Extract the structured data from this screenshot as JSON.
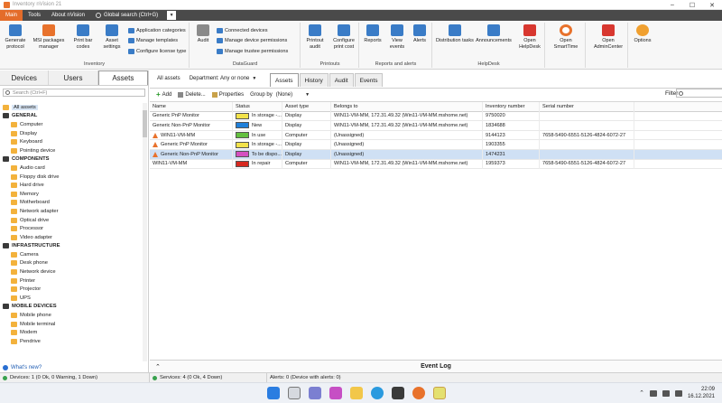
{
  "window": {
    "title": "Inventory nVision 21"
  },
  "menu_tabs": [
    {
      "label": "Main",
      "active": true
    },
    {
      "label": "Tools",
      "active": false
    },
    {
      "label": "About nVision",
      "active": false
    },
    {
      "label": "Global search (Ctrl+G)",
      "active": false
    }
  ],
  "ribbon": {
    "groups": {
      "inventory": "Inventory",
      "dataguard": "DataGuard",
      "printouts": "Printouts",
      "reports_alerts": "Reports and alerts",
      "helpdesk": "HelpDesk"
    },
    "buttons": {
      "generate_protocol": "Generate protocol",
      "msi_packages": "MSI packages manager",
      "print_bar_codes": "Print bar codes",
      "asset_settings": "Asset settings",
      "application_categories": "Application categories",
      "manage_templates": "Manage templates",
      "configure_license_type": "Configure license type",
      "audit": "Audit",
      "connected_devices": "Connected devices",
      "manage_device_permissions": "Manage device permissions",
      "manage_trustee_permissions": "Manage trustee permissions",
      "printout_audit": "Printout audit",
      "configure_print_cost": "Configure print cost",
      "reports": "Reports",
      "view_events": "View events",
      "alerts": "Alerts",
      "distribution_tasks": "Distribution tasks",
      "announcements": "Announcements",
      "open_helpdesk": "Open HelpDesk",
      "open_smarttime": "Open SmartTime",
      "open_admincenter": "Open AdminCenter",
      "options": "Options"
    }
  },
  "left_panel": {
    "tabs": [
      {
        "label": "Devices",
        "active": false
      },
      {
        "label": "Users",
        "active": false
      },
      {
        "label": "Assets",
        "active": true
      }
    ],
    "search_placeholder": "Search (Ctrl+F)",
    "tree": [
      {
        "kind": "root",
        "label": "All assets"
      },
      {
        "kind": "cat",
        "label": "GENERAL"
      },
      {
        "kind": "item",
        "label": "Computer"
      },
      {
        "kind": "item",
        "label": "Display"
      },
      {
        "kind": "item",
        "label": "Keyboard"
      },
      {
        "kind": "item",
        "label": "Pointing device"
      },
      {
        "kind": "cat",
        "label": "COMPONENTS"
      },
      {
        "kind": "item",
        "label": "Audio card"
      },
      {
        "kind": "item",
        "label": "Floppy disk drive"
      },
      {
        "kind": "item",
        "label": "Hard drive"
      },
      {
        "kind": "item",
        "label": "Memory"
      },
      {
        "kind": "item",
        "label": "Motherboard"
      },
      {
        "kind": "item",
        "label": "Network adapter"
      },
      {
        "kind": "item",
        "label": "Optical drive"
      },
      {
        "kind": "item",
        "label": "Processor"
      },
      {
        "kind": "item",
        "label": "Video adapter"
      },
      {
        "kind": "cat",
        "label": "INFRASTRUCTURE"
      },
      {
        "kind": "item",
        "label": "Camera"
      },
      {
        "kind": "item",
        "label": "Desk phone"
      },
      {
        "kind": "item",
        "label": "Network device"
      },
      {
        "kind": "item",
        "label": "Printer"
      },
      {
        "kind": "item",
        "label": "Projector"
      },
      {
        "kind": "item",
        "label": "UPS"
      },
      {
        "kind": "cat",
        "label": "MOBILE DEVICES"
      },
      {
        "kind": "item",
        "label": "Mobile phone"
      },
      {
        "kind": "item",
        "label": "Mobile terminal"
      },
      {
        "kind": "item",
        "label": "Modem"
      },
      {
        "kind": "item",
        "label": "Pendrive"
      }
    ],
    "whats_new": "What's new?"
  },
  "right_panel": {
    "all_assets": "All assets",
    "department": "Department: Any or none",
    "tabs": [
      {
        "label": "Assets",
        "active": true
      },
      {
        "label": "History",
        "active": false
      },
      {
        "label": "Audit",
        "active": false
      },
      {
        "label": "Events",
        "active": false
      }
    ],
    "toolbar": {
      "add": "Add",
      "delete": "Delete...",
      "properties": "Properties",
      "group_by_label": "Group by",
      "group_by_value": "(None)",
      "filter_label": "Filter"
    },
    "columns": [
      "Name",
      "Status",
      "Asset type",
      "Belongs to",
      "Inventory number",
      "Serial number"
    ],
    "rows": [
      {
        "warn": false,
        "name": "Generic PnP Monitor",
        "status": "In storage -...",
        "status_color": "#f2e24a",
        "type": "Display",
        "belongs": "WIN11-VM-MM, 172.31.49.32 (Win11-VM-MM.mshome.net)",
        "inv": "9750020",
        "serial": "",
        "selected": false
      },
      {
        "warn": false,
        "name": "Generic Non-PnP Monitor",
        "status": "New",
        "status_color": "#1f7fd9",
        "type": "Display",
        "belongs": "WIN11-VM-MM, 172.31.49.32 (Win11-VM-MM.mshome.net)",
        "inv": "1834688",
        "serial": "",
        "selected": false
      },
      {
        "warn": true,
        "name": "WIN11-VM-MM",
        "status": "In use",
        "status_color": "#62bf3e",
        "type": "Computer",
        "belongs": "(Unassigned)",
        "inv": "9144123",
        "serial": "7658-5490-6551-5126-4824-6072-27",
        "selected": false
      },
      {
        "warn": true,
        "name": "Generic PnP Monitor",
        "status": "In storage -...",
        "status_color": "#f2e24a",
        "type": "Display",
        "belongs": "(Unassigned)",
        "inv": "1903355",
        "serial": "",
        "selected": false
      },
      {
        "warn": true,
        "name": "Generic Non-PnP Monitor",
        "status": "To be dispo...",
        "status_color": "#d54fbf",
        "type": "Display",
        "belongs": "(Unassigned)",
        "inv": "1474231",
        "serial": "",
        "selected": true
      },
      {
        "warn": false,
        "name": "WIN11-VM-MM",
        "status": "In repair",
        "status_color": "#d6281f",
        "type": "Computer",
        "belongs": "WIN11-VM-MM, 172.31.49.32 (Win11-VM-MM.mshome.net)",
        "inv": "1959373",
        "serial": "7658-5490-6551-5126-4824-6072-27",
        "selected": false
      }
    ],
    "event_log": "Event Log"
  },
  "status_bar": {
    "devices": "Devices: 1 (0 Ok, 0 Warning, 1 Down)",
    "services": "Services: 4 (0 Ok, 4 Down)",
    "alerts": "Alerts: 0 (Device with alerts: 0)"
  },
  "taskbar": {
    "time": "22:09",
    "date": "16.12.2021"
  },
  "colors": {
    "accent": "#e46c2a",
    "menu_bg": "#4a4a4a",
    "selection": "#cfe0f4"
  }
}
